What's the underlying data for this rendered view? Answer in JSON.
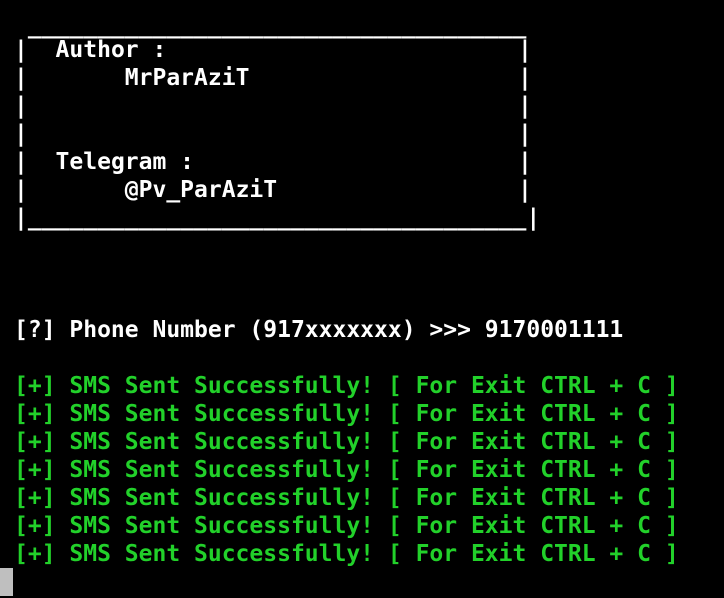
{
  "colors": {
    "background": "#000000",
    "text": "#ffffff",
    "success": "#22d12a",
    "cursor": "#bfbfbf"
  },
  "banner": {
    "top_border": " ____________________________________",
    "bottom_border": "|____________________________________|",
    "left_bar": "|",
    "right_bar": "|",
    "author_label": "  Author :",
    "author_value": "       MrParAziT",
    "telegram_label": "  Telegram :",
    "telegram_value": "       @Pv_ParAziT"
  },
  "prompt": {
    "text": "[?] Phone Number (917xxxxxxx) >>> 9170001111"
  },
  "messages": [
    "[+] SMS Sent Successfully! [ For Exit CTRL + C ]",
    "[+] SMS Sent Successfully! [ For Exit CTRL + C ]",
    "[+] SMS Sent Successfully! [ For Exit CTRL + C ]",
    "[+] SMS Sent Successfully! [ For Exit CTRL + C ]",
    "[+] SMS Sent Successfully! [ For Exit CTRL + C ]",
    "[+] SMS Sent Successfully! [ For Exit CTRL + C ]",
    "[+] SMS Sent Successfully! [ For Exit CTRL + C ]"
  ],
  "cursor": {
    "icon": "block-cursor"
  }
}
